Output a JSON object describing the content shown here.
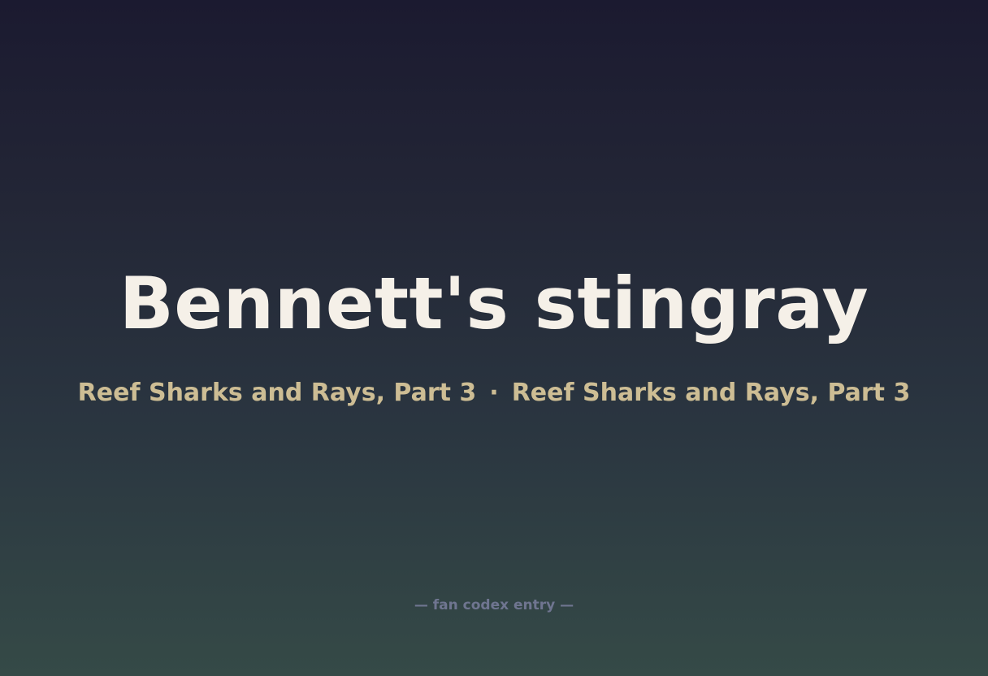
{
  "card": {
    "title": "Bennett's stingray",
    "subtitle_left": "Reef Sharks and Rays, Part 3",
    "separator": "·",
    "subtitle_right": "Reef Sharks and Rays, Part 3",
    "footer": "— fan codex entry —"
  },
  "colors": {
    "title": "#f5f0e8",
    "subtitle": "#cdbd94",
    "footer": "#6f7590",
    "background_top": "#1b1a30",
    "background_bottom": "#354a47"
  }
}
